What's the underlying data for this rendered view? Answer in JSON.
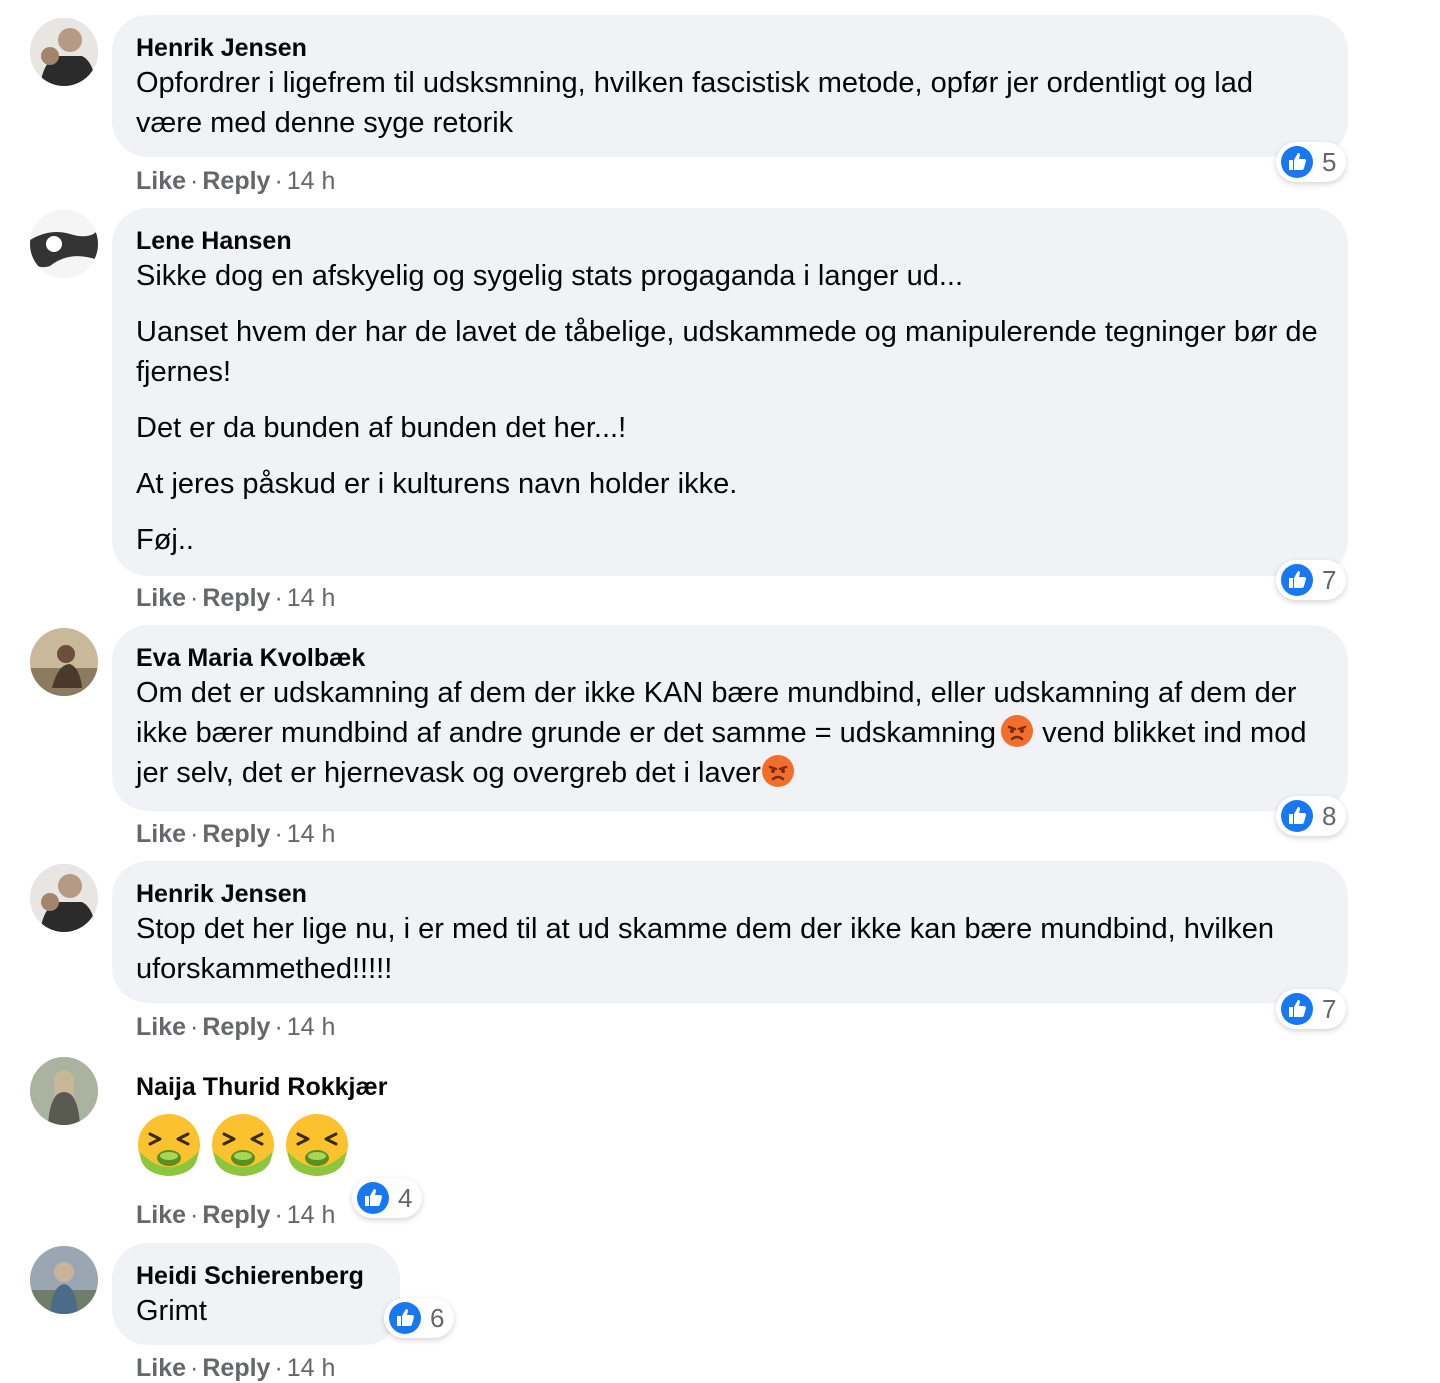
{
  "comments": [
    {
      "author": "Henrik Jensen",
      "text": "Opfordrer i ligefrem til udsksmning, hvilken fascistisk metode, opfør jer ordentligt og lad være med denne syge retorik",
      "like_label": "Like",
      "reply_label": "Reply",
      "time": "14 h",
      "reaction_count": "5"
    },
    {
      "author": "Lene Hansen",
      "paragraphs": [
        "Sikke dog en afskyelig og sygelig stats progaganda i langer ud...",
        "Uanset hvem der har de lavet de tåbelige, udskammede og manipulerende tegninger bør de fjernes!",
        "Det er da bunden af bunden det her...!",
        "At jeres påskud er i kulturens navn holder ikke.",
        "Føj.."
      ],
      "like_label": "Like",
      "reply_label": "Reply",
      "time": "14 h",
      "reaction_count": "7"
    },
    {
      "author": "Eva Maria Kvolbæk",
      "text_part1": "Om det er udskamning af dem der ikke KAN bære mundbind, eller udskamning af dem der ikke bærer mundbind af andre grunde er det samme = udskamning",
      "text_part2": "vend blikket ind mod jer selv, det er hjernevask og overgreb det i laver",
      "emoji": "angry-face",
      "like_label": "Like",
      "reply_label": "Reply",
      "time": "14 h",
      "reaction_count": "8"
    },
    {
      "author": "Henrik Jensen",
      "text": "Stop det her lige nu, i er med til at ud skamme dem der ikke kan bære mundbind, hvilken uforskammethed!!!!!",
      "like_label": "Like",
      "reply_label": "Reply",
      "time": "14 h",
      "reaction_count": "7"
    },
    {
      "author": "Naija Thurid Rokkjær",
      "emoji": "nauseated-face",
      "emoji_count": 3,
      "like_label": "Like",
      "reply_label": "Reply",
      "time": "14 h",
      "reaction_count": "4"
    },
    {
      "author": "Heidi Schierenberg",
      "text": "Grimt",
      "like_label": "Like",
      "reply_label": "Reply",
      "time": "14 h",
      "reaction_count": "6"
    }
  ],
  "colors": {
    "bubble": "#f0f2f5",
    "meta": "#65676b",
    "like_blue": "#1877f2"
  }
}
